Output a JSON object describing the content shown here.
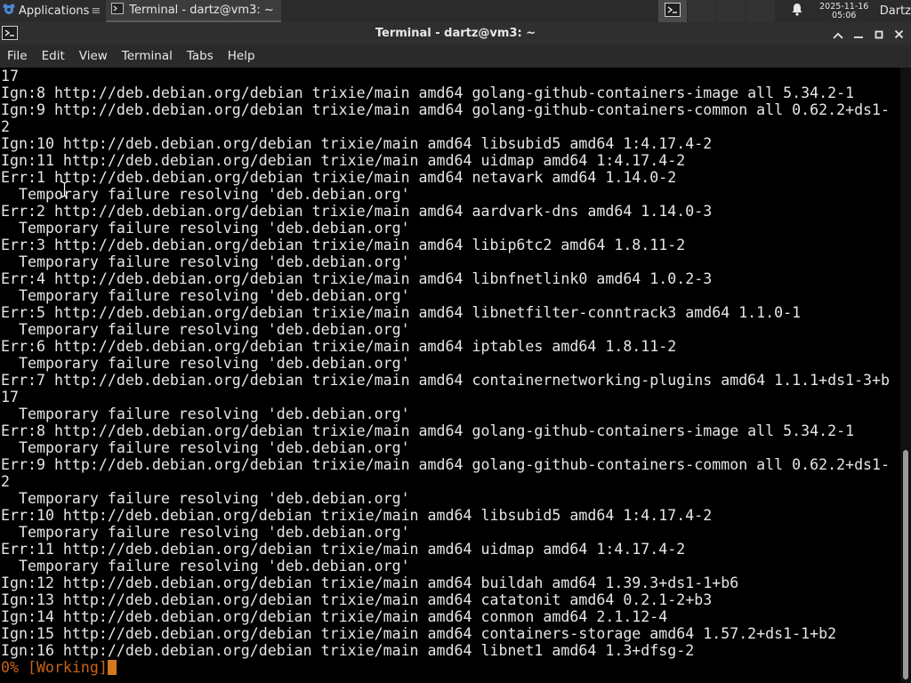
{
  "panel": {
    "applications_label": "Applications",
    "taskbar_item": "Terminal - dartz@vm3: ~",
    "clock_date": "2025-11-16",
    "clock_time": "05:06",
    "user": "Dartz"
  },
  "window": {
    "title": "Terminal - dartz@vm3: ~"
  },
  "menu": {
    "file": "File",
    "edit": "Edit",
    "view": "View",
    "terminal": "Terminal",
    "tabs": "Tabs",
    "help": "Help"
  },
  "terminal": {
    "lines": [
      "17",
      "Ign:8 http://deb.debian.org/debian trixie/main amd64 golang-github-containers-image all 5.34.2-1",
      "Ign:9 http://deb.debian.org/debian trixie/main amd64 golang-github-containers-common all 0.62.2+ds1-",
      "2",
      "Ign:10 http://deb.debian.org/debian trixie/main amd64 libsubid5 amd64 1:4.17.4-2",
      "Ign:11 http://deb.debian.org/debian trixie/main amd64 uidmap amd64 1:4.17.4-2",
      "Err:1 http://deb.debian.org/debian trixie/main amd64 netavark amd64 1.14.0-2",
      "  Temporary failure resolving 'deb.debian.org'",
      "Err:2 http://deb.debian.org/debian trixie/main amd64 aardvark-dns amd64 1.14.0-3",
      "  Temporary failure resolving 'deb.debian.org'",
      "Err:3 http://deb.debian.org/debian trixie/main amd64 libip6tc2 amd64 1.8.11-2",
      "  Temporary failure resolving 'deb.debian.org'",
      "Err:4 http://deb.debian.org/debian trixie/main amd64 libnfnetlink0 amd64 1.0.2-3",
      "  Temporary failure resolving 'deb.debian.org'",
      "Err:5 http://deb.debian.org/debian trixie/main amd64 libnetfilter-conntrack3 amd64 1.1.0-1",
      "  Temporary failure resolving 'deb.debian.org'",
      "Err:6 http://deb.debian.org/debian trixie/main amd64 iptables amd64 1.8.11-2",
      "  Temporary failure resolving 'deb.debian.org'",
      "Err:7 http://deb.debian.org/debian trixie/main amd64 containernetworking-plugins amd64 1.1.1+ds1-3+b",
      "17",
      "  Temporary failure resolving 'deb.debian.org'",
      "Err:8 http://deb.debian.org/debian trixie/main amd64 golang-github-containers-image all 5.34.2-1",
      "  Temporary failure resolving 'deb.debian.org'",
      "Err:9 http://deb.debian.org/debian trixie/main amd64 golang-github-containers-common all 0.62.2+ds1-",
      "2",
      "  Temporary failure resolving 'deb.debian.org'",
      "Err:10 http://deb.debian.org/debian trixie/main amd64 libsubid5 amd64 1:4.17.4-2",
      "  Temporary failure resolving 'deb.debian.org'",
      "Err:11 http://deb.debian.org/debian trixie/main amd64 uidmap amd64 1:4.17.4-2",
      "  Temporary failure resolving 'deb.debian.org'",
      "Ign:12 http://deb.debian.org/debian trixie/main amd64 buildah amd64 1.39.3+ds1-1+b6",
      "Ign:13 http://deb.debian.org/debian trixie/main amd64 catatonit amd64 0.2.1-2+b3",
      "Ign:14 http://deb.debian.org/debian trixie/main amd64 conmon amd64 2.1.12-4",
      "Ign:15 http://deb.debian.org/debian trixie/main amd64 containers-storage amd64 1.57.2+ds1-1+b2",
      "Ign:16 http://deb.debian.org/debian trixie/main amd64 libnet1 amd64 1.3+dfsg-2"
    ],
    "progress_line": "0% [Working]"
  },
  "colors": {
    "panel_bg": "#2b2b2b",
    "terminal_bg": "#000000",
    "terminal_fg": "#e6e6e6",
    "progress": "#c8641a",
    "cursor": "#d4781f"
  },
  "icons": {
    "applications": "xfce-mouse-icon",
    "terminal": "terminal-icon",
    "notifications": "bell-icon",
    "maximize_window": "chevron-up-icon",
    "minimize": "minimize-icon",
    "maximize": "maximize-icon",
    "close": "close-icon"
  }
}
